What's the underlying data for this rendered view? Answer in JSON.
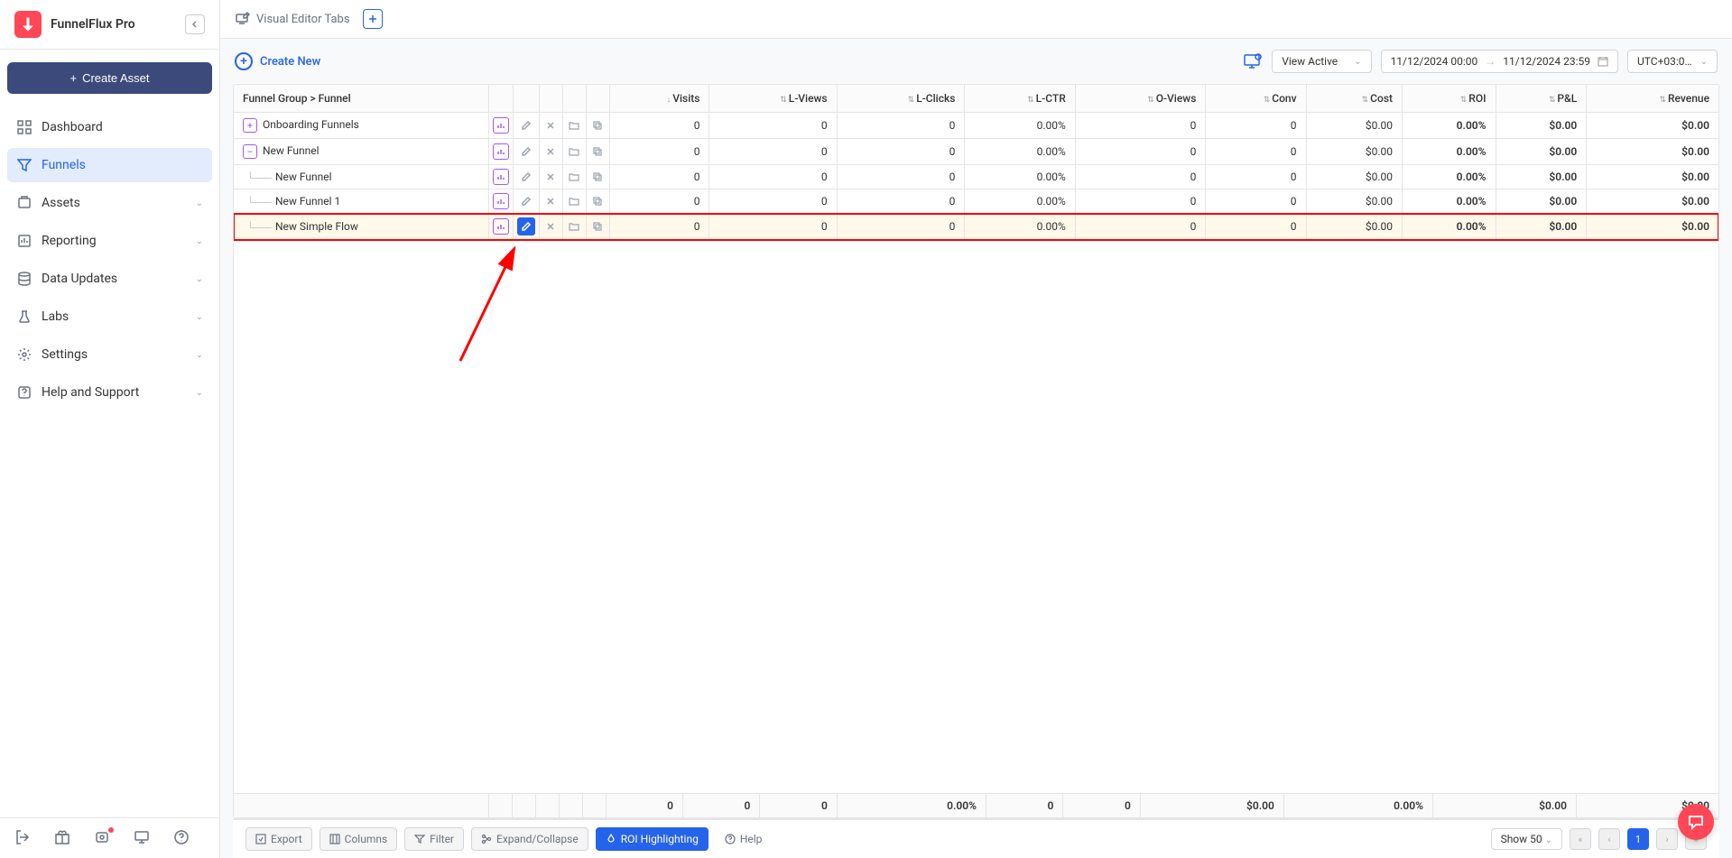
{
  "brand": "FunnelFlux Pro",
  "sidebar": {
    "create_asset": "Create Asset",
    "items": [
      {
        "label": "Dashboard"
      },
      {
        "label": "Funnels"
      },
      {
        "label": "Assets"
      },
      {
        "label": "Reporting"
      },
      {
        "label": "Data Updates"
      },
      {
        "label": "Labs"
      },
      {
        "label": "Settings"
      },
      {
        "label": "Help and Support"
      }
    ]
  },
  "topbar": {
    "visual_editor": "Visual Editor Tabs"
  },
  "toolbar": {
    "create_new": "Create New",
    "view_active": "View Active",
    "date_from": "11/12/2024 00:00",
    "date_to": "11/12/2024 23:59",
    "timezone": "UTC+03:00…"
  },
  "table": {
    "header_group": "Funnel Group > Funnel",
    "columns": [
      "Visits",
      "L-Views",
      "L-Clicks",
      "L-CTR",
      "O-Views",
      "Conv",
      "Cost",
      "ROI",
      "P&L",
      "Revenue"
    ],
    "rows": [
      {
        "expand": "+",
        "indent": 0,
        "name": "Onboarding Funnels",
        "values": [
          "0",
          "0",
          "0",
          "0.00%",
          "0",
          "0",
          "$0.00",
          "0.00%",
          "$0.00",
          "$0.00"
        ],
        "highlighted": false,
        "edit_hl": false
      },
      {
        "expand": "–",
        "indent": 0,
        "name": "New Funnel",
        "values": [
          "0",
          "0",
          "0",
          "0.00%",
          "0",
          "0",
          "$0.00",
          "0.00%",
          "$0.00",
          "$0.00"
        ],
        "highlighted": false,
        "edit_hl": false
      },
      {
        "expand": "",
        "indent": 1,
        "name": "New Funnel",
        "values": [
          "0",
          "0",
          "0",
          "0.00%",
          "0",
          "0",
          "$0.00",
          "0.00%",
          "$0.00",
          "$0.00"
        ],
        "highlighted": false,
        "edit_hl": false
      },
      {
        "expand": "",
        "indent": 1,
        "name": "New Funnel 1",
        "values": [
          "0",
          "0",
          "0",
          "0.00%",
          "0",
          "0",
          "$0.00",
          "0.00%",
          "$0.00",
          "$0.00"
        ],
        "highlighted": false,
        "edit_hl": false
      },
      {
        "expand": "",
        "indent": 1,
        "name": "New Simple Flow",
        "values": [
          "0",
          "0",
          "0",
          "0.00%",
          "0",
          "0",
          "$0.00",
          "0.00%",
          "$0.00",
          "$0.00"
        ],
        "highlighted": true,
        "edit_hl": true
      }
    ],
    "totals": [
      "0",
      "0",
      "0",
      "0.00%",
      "0",
      "0",
      "$0.00",
      "0.00%",
      "$0.00",
      "$0.00"
    ]
  },
  "footer": {
    "export": "Export",
    "columns": "Columns",
    "filter": "Filter",
    "expand": "Expand/Collapse",
    "roi": "ROI Highlighting",
    "help": "Help",
    "page_size": "Show 50",
    "page_current": "1"
  }
}
